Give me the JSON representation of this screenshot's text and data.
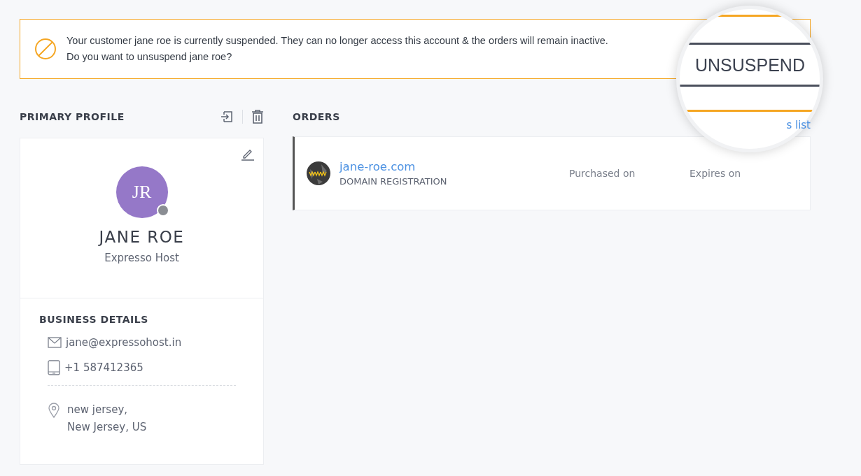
{
  "alert": {
    "lines": [
      "Your customer jane roe is currently suspended. They can no longer access this account & the orders will remain inactive.",
      "Do you want to unsuspend jane roe?"
    ]
  },
  "magnifier": {
    "button": "UNSUSPEND"
  },
  "profile": {
    "heading": "PRIMARY PROFILE",
    "initials": "JR",
    "online": false,
    "name": "JANE ROE",
    "company": "Expresso Host",
    "details_heading": "BUSINESS DETAILS",
    "email": "jane@expressohost.in",
    "phone": "+1 587412365",
    "address": [
      "new jersey,",
      "New Jersey, US"
    ]
  },
  "orders": {
    "heading": "ORDERS",
    "list_link": "s list",
    "items": [
      {
        "domain": "jane-roe.com",
        "product": "DOMAIN REGISTRATION",
        "purchased": "Purchased on",
        "expires": "Expires on"
      }
    ]
  }
}
